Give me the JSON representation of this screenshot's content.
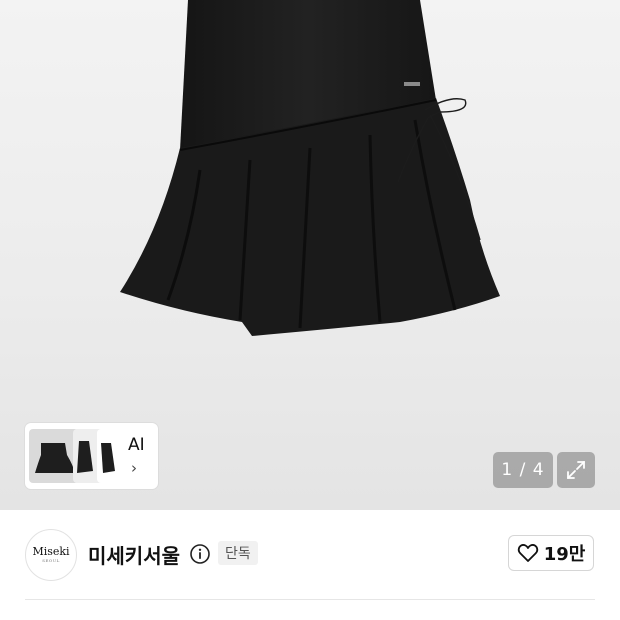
{
  "gallery": {
    "ai_label": "AI",
    "ai_chevron": "›",
    "counter": "1 / 4",
    "expand_icon": "expand-icon",
    "colors": {
      "overlay": "#787878",
      "product": "#1b1b1b"
    }
  },
  "brand": {
    "logo_text": "Miseki",
    "logo_subtext": "SEOUL",
    "name": "미세키서울",
    "badge": "단독",
    "info_icon": "info-icon"
  },
  "like": {
    "icon": "heart-icon",
    "count": "19만"
  }
}
